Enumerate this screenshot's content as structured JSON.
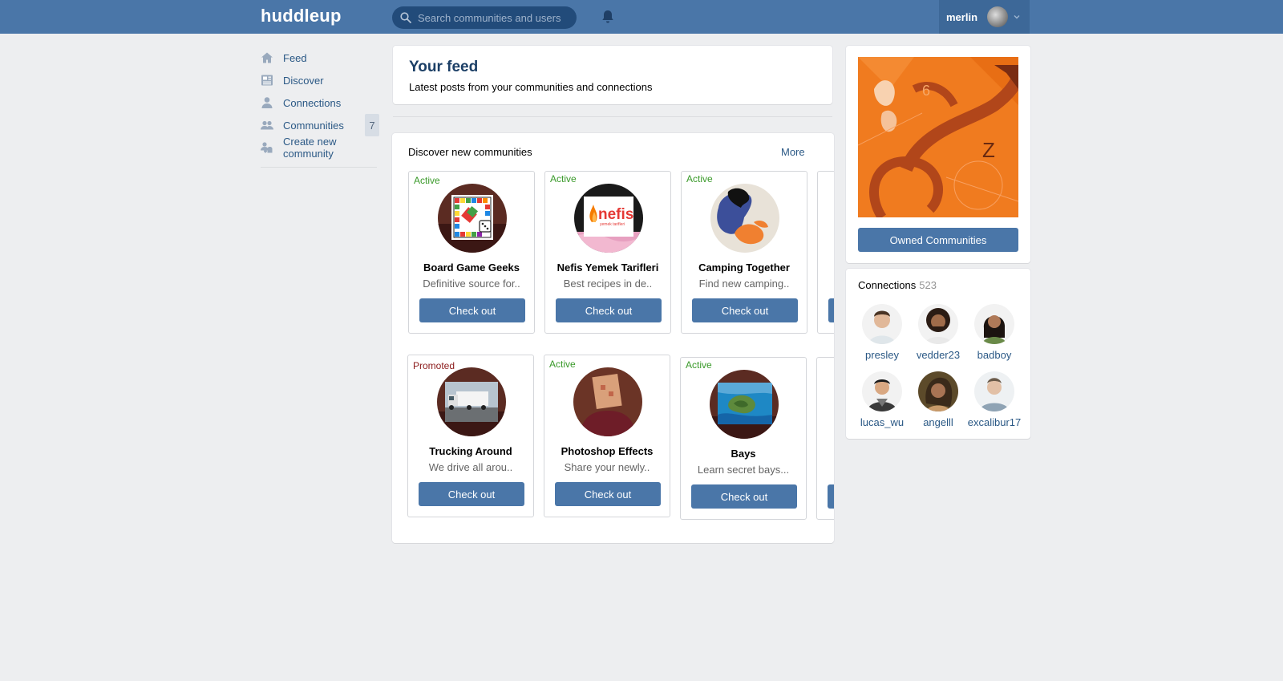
{
  "header": {
    "logo": "huddleup",
    "search_placeholder": "Search communities and users",
    "username": "merlin",
    "colors": {
      "bar": "#4a76a8",
      "search": "#224b7a"
    }
  },
  "nav": {
    "items": [
      {
        "label": "Feed",
        "icon": "home-icon"
      },
      {
        "label": "Discover",
        "icon": "newspaper-icon"
      },
      {
        "label": "Connections",
        "icon": "user-icon"
      },
      {
        "label": "Communities",
        "icon": "users-icon",
        "badge": "7"
      },
      {
        "label": "Create new community",
        "icon": "group-add-icon"
      }
    ]
  },
  "feed": {
    "title": "Your feed",
    "subtitle": "Latest posts from your communities and connections"
  },
  "discover": {
    "title": "Discover new communities",
    "more_label": "More",
    "communities": [
      {
        "status": "Active",
        "name": "Board Game Geeks",
        "desc": "Definitive source for..",
        "button": "Check out"
      },
      {
        "status": "Active",
        "name": "Nefis Yemek Tarifleri",
        "desc": "Best recipes in de..",
        "button": "Check out",
        "logo_text": "nefis",
        "logo_sub": "yemek tarifleri"
      },
      {
        "status": "Active",
        "name": "Camping Together",
        "desc": "Find new camping..",
        "button": "Check out"
      },
      {
        "status": "Promoted",
        "name": "Trucking Around",
        "desc": "We drive all arou..",
        "button": "Check out"
      },
      {
        "status": "Active",
        "name": "Photoshop Effects",
        "desc": "Share your newly..",
        "button": "Check out"
      },
      {
        "status": "Active",
        "name": "Bays",
        "desc": "Learn secret bays...",
        "button": "Check out"
      }
    ]
  },
  "sidebar": {
    "owned_button": "Owned Communities",
    "connections_title": "Connections",
    "connections_count": "523",
    "people": [
      {
        "name": "presley"
      },
      {
        "name": "vedder23"
      },
      {
        "name": "badboy"
      },
      {
        "name": "lucas_wu"
      },
      {
        "name": "angelll"
      },
      {
        "name": "excalibur17"
      }
    ]
  }
}
